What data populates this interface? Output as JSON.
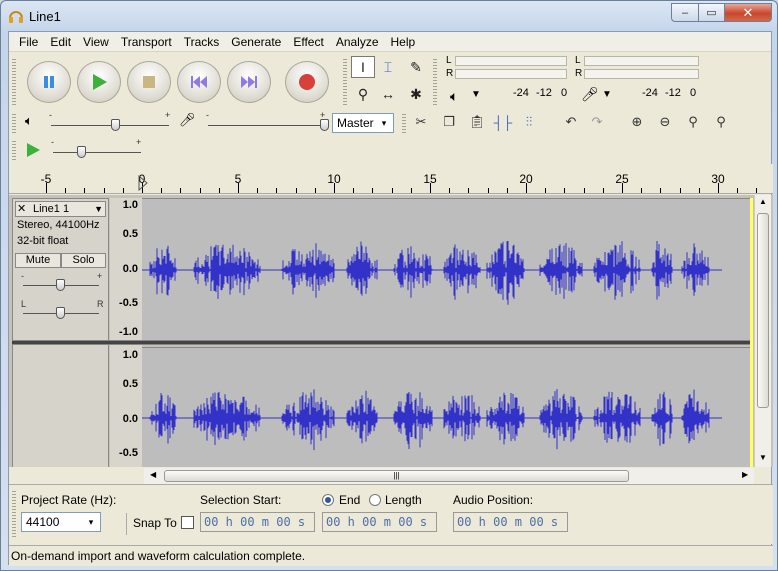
{
  "window": {
    "title": "Line1",
    "controls": {
      "min": "–",
      "max": "▭",
      "close": "✕"
    }
  },
  "menu": [
    "File",
    "Edit",
    "View",
    "Transport",
    "Tracks",
    "Generate",
    "Effect",
    "Analyze",
    "Help"
  ],
  "meters": {
    "play": {
      "channel_l": "L",
      "channel_r": "R",
      "scale": [
        "-24",
        "-12",
        "0"
      ]
    },
    "record": {
      "channel_l": "L",
      "channel_r": "R",
      "scale": [
        "-24",
        "-12",
        "0"
      ]
    }
  },
  "mixer": {
    "input_source": "Master",
    "dropdown": "▾"
  },
  "ruler": {
    "labels": [
      "-5",
      "0",
      "5",
      "10",
      "15",
      "20",
      "25",
      "30"
    ]
  },
  "track": {
    "name": "Line1 1",
    "close": "✕",
    "menu_arrow": "▼",
    "format": "Stereo, 44100Hz",
    "bitdepth": "32-bit float",
    "mute_label": "Mute",
    "solo_label": "Solo",
    "gain_minus": "-",
    "gain_plus": "+",
    "pan_left": "L",
    "pan_right": "R",
    "scale_top": [
      "1.0",
      "0.5",
      "0.0",
      "-0.5",
      "-1.0"
    ],
    "scale_bottom": [
      "1.0",
      "0.5",
      "0.0",
      "-0.5"
    ]
  },
  "selection_bar": {
    "project_rate_label": "Project Rate (Hz):",
    "project_rate_value": "44100",
    "snap_to_label": "Snap To",
    "selection_start_label": "Selection Start:",
    "end_label": "End",
    "length_label": "Length",
    "audio_position_label": "Audio Position:",
    "time_start": "00 h 00 m 00 s",
    "time_end": "00 h 00 m 00 s",
    "time_position": "00 h 00 m 00 s"
  },
  "status": "On-demand import and waveform calculation complete.",
  "colors": {
    "waveform": "#3232c8",
    "wave_bg": "#bdbdbd",
    "accent": "#2a5a9c"
  }
}
